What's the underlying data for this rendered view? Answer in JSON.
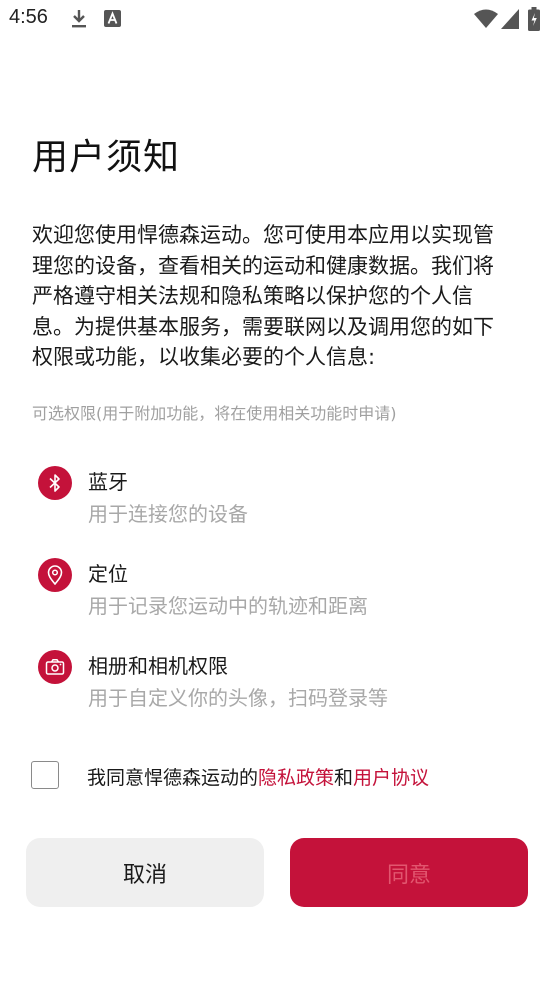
{
  "status_bar": {
    "time": "4:56",
    "icons": [
      "download-icon",
      "font-a-icon",
      "wifi-icon",
      "signal-icon",
      "battery-charging-icon"
    ]
  },
  "page": {
    "title": "用户须知",
    "intro": "欢迎您使用悍德森运动。您可使用本应用以实现管理您的设备，查看相关的运动和健康数据。我们将严格遵守相关法规和隐私策略以保护您的个人信息。为提供基本服务，需要联网以及调用您的如下权限或功能，以收集必要的个人信息:",
    "optional_note": "可选权限(用于附加功能，将在使用相关功能时申请)"
  },
  "permissions": [
    {
      "icon": "bluetooth-icon",
      "title": "蓝牙",
      "desc": "用于连接您的设备"
    },
    {
      "icon": "location-pin-icon",
      "title": "定位",
      "desc": "用于记录您运动中的轨迹和距离"
    },
    {
      "icon": "camera-icon",
      "title": "相册和相机权限",
      "desc": "用于自定义你的头像，扫码登录等"
    }
  ],
  "agreement": {
    "checked": false,
    "prefix": "我同意悍德森运动的",
    "privacy_link": "隐私政策",
    "conjunction": "和",
    "user_link": "用户协议"
  },
  "buttons": {
    "cancel": "取消",
    "agree": "同意"
  },
  "colors": {
    "accent": "#c4123a",
    "button_gray": "#efefef",
    "muted_text": "#a8a8a8"
  }
}
